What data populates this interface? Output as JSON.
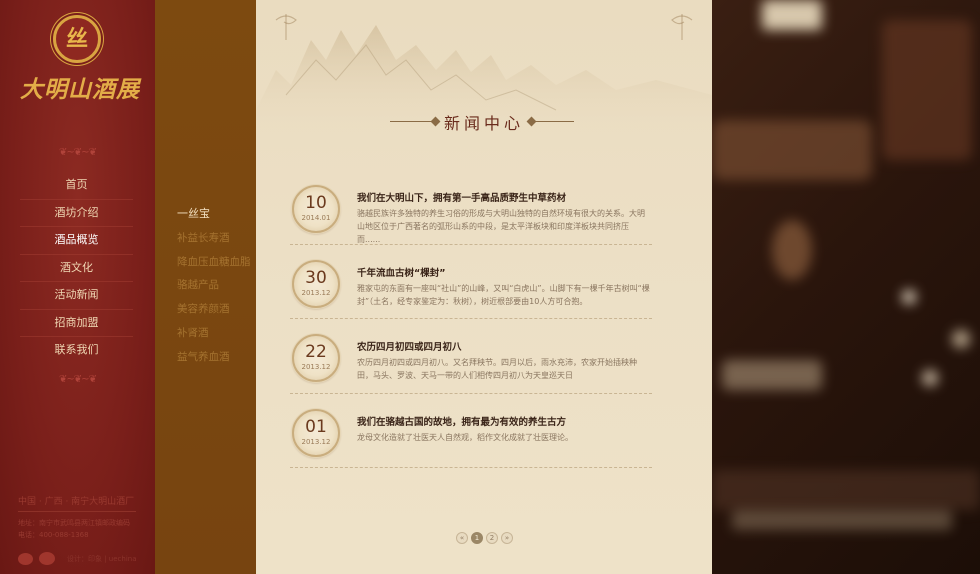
{
  "brand": {
    "badge_text": "丝",
    "name": "大明山酒展"
  },
  "nav": {
    "items": [
      "首页",
      "酒坊介绍",
      "酒品概览",
      "酒文化",
      "活动新闻",
      "招商加盟",
      "联系我们"
    ],
    "active_index": 2
  },
  "footer": {
    "location": "中国 · 广西 · 南宁大明山酒厂",
    "address": "地址：南宁市武鸣县两江镇邮政编码",
    "phone": "电话：400-088-1368",
    "credit": "设计：印象 | uechina"
  },
  "submenu": {
    "items": [
      "一丝宝",
      "补益长寿酒",
      "降血压血糖血脂",
      "骆越产品",
      "美容养颜酒",
      "补肾酒",
      "益气养血酒"
    ],
    "active_index": 0
  },
  "section": {
    "title": "新闻中心"
  },
  "news": [
    {
      "day": "10",
      "year_month": "2014.01",
      "title": "我们在大明山下，拥有第一手高品质野生中草药材",
      "summary": "骆越民族许多独特的养生习俗的形成与大明山独特的自然环境有很大的关系。大明山地区位于广西著名的弧形山系的中段，是太平洋板块和印度洋板块共同挤压而......"
    },
    {
      "day": "30",
      "year_month": "2013.12",
      "title": "千年流血古树“棵封”",
      "summary": "雅家屯的东面有一座叫“社山”的山峰，又叫“白虎山”。山脚下有一棵千年古树叫“棵封”（土名，经专家鉴定为：秋树），树近根部要由10人方可合抱。"
    },
    {
      "day": "22",
      "year_month": "2013.12",
      "title": "农历四月初四或四月初八",
      "summary": "农历四月初四或四月初八。又名拜秧节。四月以后，雨水充沛，农家开始插秧种田，马头、罗波、天马一带的人们相传四月初八为天皇巡天日"
    },
    {
      "day": "01",
      "year_month": "2013.12",
      "title": "我们在骆越古国的故地，拥有最为有效的养生古方",
      "summary": "龙母文化造就了壮医天人自然观，稻作文化成就了壮医理论。"
    }
  ],
  "pager": {
    "prev": "«",
    "pages": [
      "1",
      "2"
    ],
    "current": "1",
    "next": "»"
  },
  "colors": {
    "sidebar_red": "#7a1f1a",
    "submenu_brown": "#7d4a10",
    "parchment": "#ecdfc5",
    "gold": "#e3ad48"
  }
}
